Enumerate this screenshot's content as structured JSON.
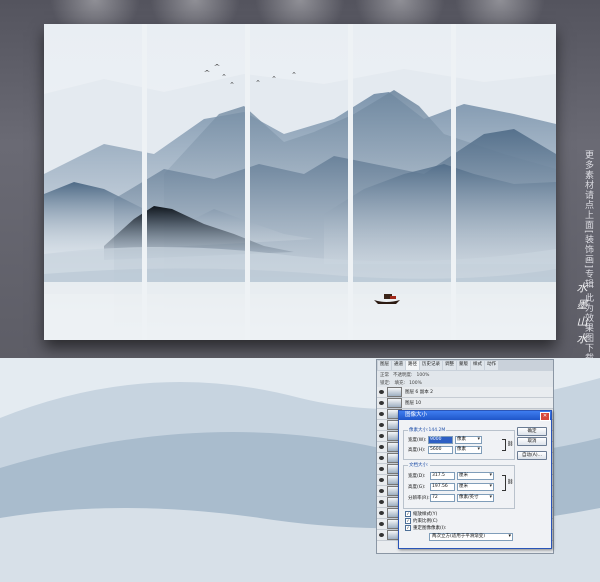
{
  "colors": {
    "wall": "#5d5d66",
    "mountain_dark": "#1d2733",
    "mountain_mid": "#5c7792",
    "mist": "#eef2f5",
    "dialog_title": "#2a5fcf"
  },
  "side_note": "更多素材请点上面[装饰画]专辑 此为效果图下载文件为分层图",
  "seal": "水墨山水",
  "photoshop": {
    "tabs": [
      "图层",
      "通道",
      "路径",
      "历史记录",
      "调整",
      "蒙版",
      "样式",
      "动作"
    ],
    "opts": [
      "正常",
      "不透明度:",
      "100%",
      "锁定:",
      "填充:",
      "100%"
    ],
    "layers": [
      "图层 6 副本 2",
      "图层 10",
      "图层 1",
      "图层 2",
      "图层 3",
      "图层 4",
      "图层 5",
      "图层 6",
      "图层 7",
      "图层 8",
      "图层 9",
      "图层 11",
      "图层 12",
      "背景"
    ],
    "dialog": {
      "title": "图像大小",
      "pixel_group": "像素大小:144.2M",
      "width_label": "宽度(W):",
      "width_value": "9000",
      "height_label": "高度(H):",
      "height_value": "5600",
      "pixel_unit": "像素",
      "doc_group": "文档大小:",
      "doc_width_label": "宽度(D):",
      "doc_width_value": "317.5",
      "doc_height_label": "高度(G):",
      "doc_height_value": "197.56",
      "resolution_label": "分辨率(R):",
      "resolution_value": "72",
      "cm_unit": "厘米",
      "res_unit": "像素/英寸",
      "ok": "确定",
      "cancel": "取消",
      "auto": "自动(A)...",
      "check1": "缩放样式(Y)",
      "check2": "约束比例(C)",
      "check3": "重定图像像素(I):",
      "resample": "两次立方(适用于平滑渐变)"
    }
  }
}
